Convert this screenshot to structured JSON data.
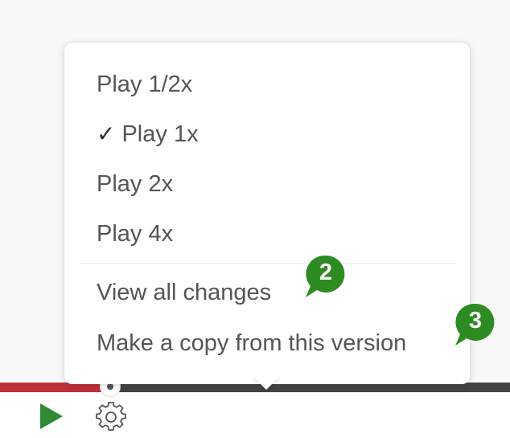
{
  "menu": {
    "items": [
      {
        "label": "Play 1/2x",
        "checked": false
      },
      {
        "label": "Play 1x",
        "checked": true
      },
      {
        "label": "Play 2x",
        "checked": false
      },
      {
        "label": "Play 4x",
        "checked": false
      }
    ],
    "check_glyph": "✓",
    "actions": [
      {
        "label": "View all changes"
      },
      {
        "label": "Make a copy from this version"
      }
    ]
  },
  "callouts": [
    {
      "number": "2",
      "color": "#2e8b22"
    },
    {
      "number": "3",
      "color": "#2e8b22"
    }
  ],
  "player": {
    "progress_fraction": 0.2,
    "play_icon": "play-icon",
    "settings_icon": "gear-icon",
    "colors": {
      "play": "#2f8a35",
      "progress": "#c0303a",
      "track": "#444444"
    }
  }
}
